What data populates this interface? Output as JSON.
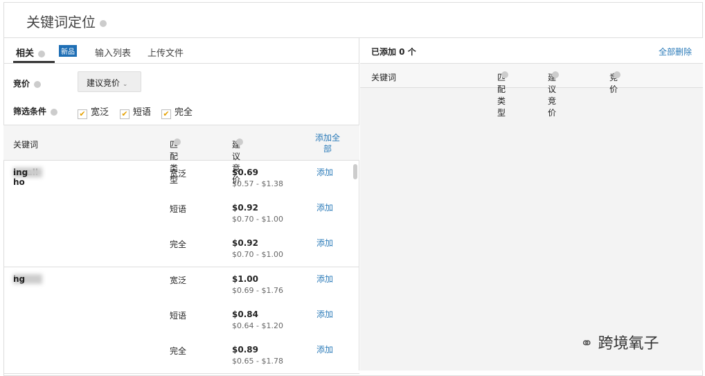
{
  "title": "关键词定位",
  "tabs": [
    {
      "label": "相关",
      "active": true
    },
    {
      "label": "输入列表"
    },
    {
      "label": "上传文件"
    }
  ],
  "badge": "新品",
  "filters": {
    "bid_label": "竞价",
    "bid_dropdown": "建议竞价",
    "filter_label": "筛选条件",
    "options": [
      "宽泛",
      "短语",
      "完全"
    ]
  },
  "table": {
    "headers": {
      "keyword": "关键词",
      "match": "匹配类型",
      "suggested": "建议竞价",
      "add_all": "添加全部"
    },
    "groups": [
      {
        "kw_pre": "small ho",
        "kw_post": "ing",
        "rows": [
          {
            "match": "宽泛",
            "bid": "$0.69",
            "range": "$0.57 - $1.38",
            "add": "添加"
          },
          {
            "match": "短语",
            "bid": "$0.92",
            "range": "$0.70 - $1.00",
            "add": "添加"
          },
          {
            "match": "完全",
            "bid": "$0.92",
            "range": "$0.70 - $1.00",
            "add": "添加"
          }
        ]
      },
      {
        "kw_pre": "ho",
        "kw_post": "ng",
        "rows": [
          {
            "match": "宽泛",
            "bid": "$1.00",
            "range": "$0.69 - $1.76",
            "add": "添加"
          },
          {
            "match": "短语",
            "bid": "$0.84",
            "range": "$0.64 - $1.20",
            "add": "添加"
          },
          {
            "match": "完全",
            "bid": "$0.89",
            "range": "$0.65 - $1.78",
            "add": "添加"
          }
        ]
      }
    ]
  },
  "right": {
    "added": "已添加 0 个",
    "remove_all": "全部删除",
    "cols": {
      "keyword": "关键词",
      "match": "匹配类型",
      "suggested": "建议竞价",
      "bid": "竞价"
    }
  },
  "watermark": "跨境氧子"
}
